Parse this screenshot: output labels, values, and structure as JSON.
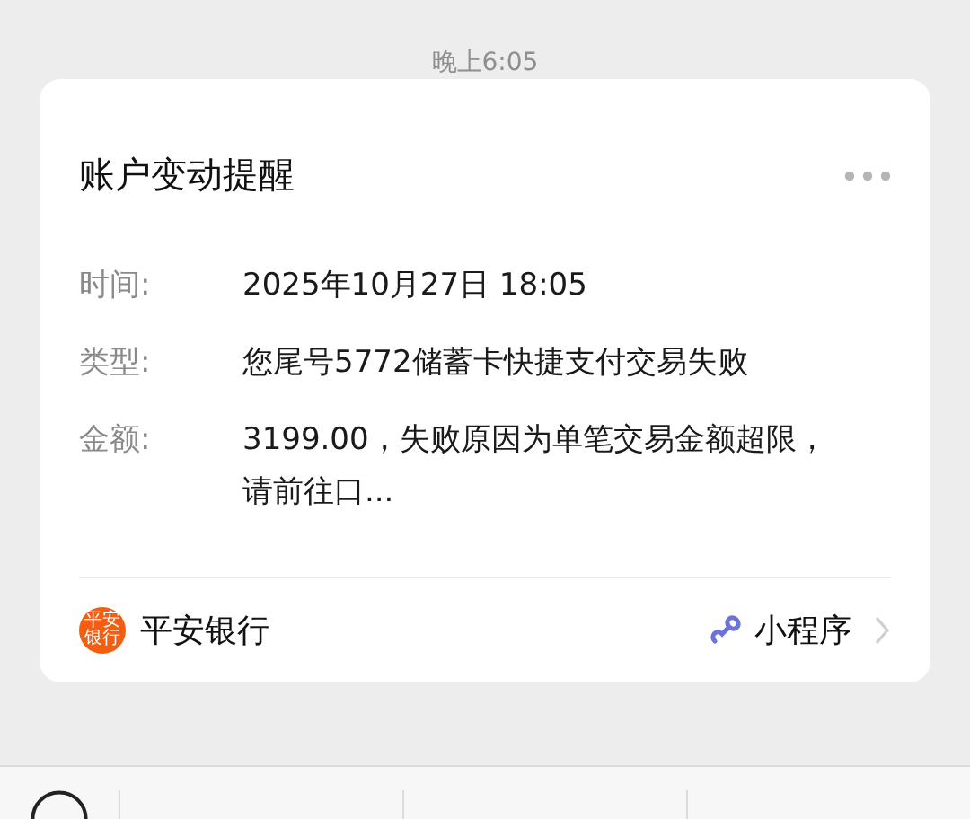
{
  "timestamp": "晚上6:05",
  "card": {
    "title": "账户变动提醒",
    "fields": [
      {
        "label": "时间:",
        "value": "2025年10月27日 18:05"
      },
      {
        "label": "类型:",
        "value": "您尾号5772储蓄卡快捷支付交易失败"
      },
      {
        "label": "金额:",
        "value": "3199.00，失败原因为单笔交易金额超限，请前往口..."
      }
    ],
    "footer": {
      "logo_text": "平安银行",
      "source": "平安银行",
      "link": "小程序"
    }
  }
}
